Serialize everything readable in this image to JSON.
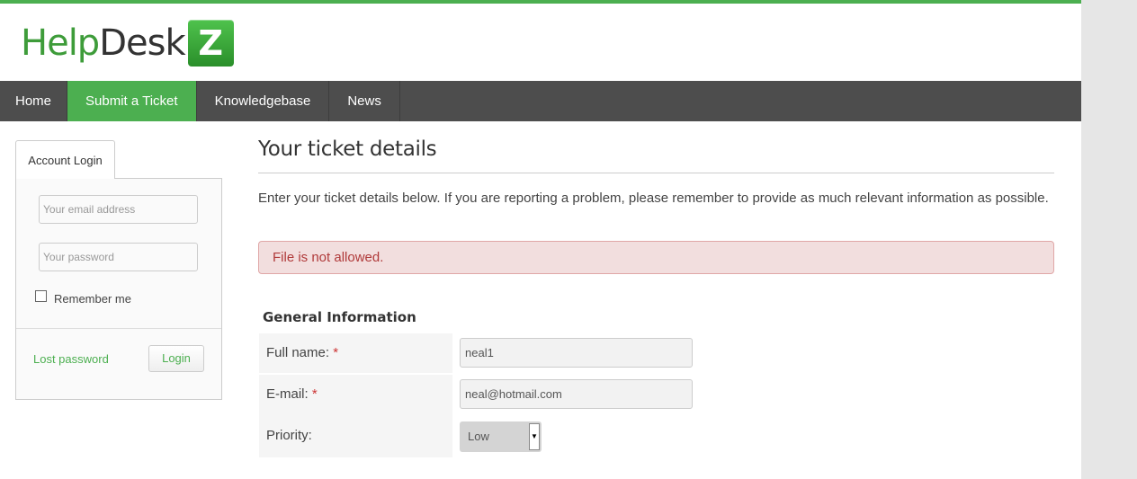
{
  "logo": {
    "part1": "Help",
    "part2": "Desk",
    "badge": "Z"
  },
  "nav": {
    "items": [
      {
        "label": "Home"
      },
      {
        "label": "Submit a Ticket"
      },
      {
        "label": "Knowledgebase"
      },
      {
        "label": "News"
      }
    ],
    "active_index": 1
  },
  "sidebar": {
    "tab_label": "Account Login",
    "email_placeholder": "Your email address",
    "password_placeholder": "Your password",
    "remember_label": "Remember me",
    "lost_password_label": "Lost password",
    "login_button_label": "Login"
  },
  "main": {
    "title": "Your ticket details",
    "intro": "Enter your ticket details below. If you are reporting a problem, please remember to provide as much relevant information as possible.",
    "error": "File is not allowed.",
    "section_title": "General Information",
    "fields": {
      "full_name": {
        "label": "Full name:",
        "required_mark": "*",
        "value": "neal1"
      },
      "email": {
        "label": "E-mail:",
        "required_mark": "*",
        "value": "neal@hotmail.com"
      },
      "priority": {
        "label": "Priority:",
        "value": "Low"
      }
    }
  },
  "colors": {
    "accent": "#4caf50",
    "nav_bg": "#4d4d4d",
    "error_bg": "#f2dede",
    "error_text": "#b03a3a"
  },
  "icons": {
    "select_arrow": "chevron-down-icon"
  }
}
